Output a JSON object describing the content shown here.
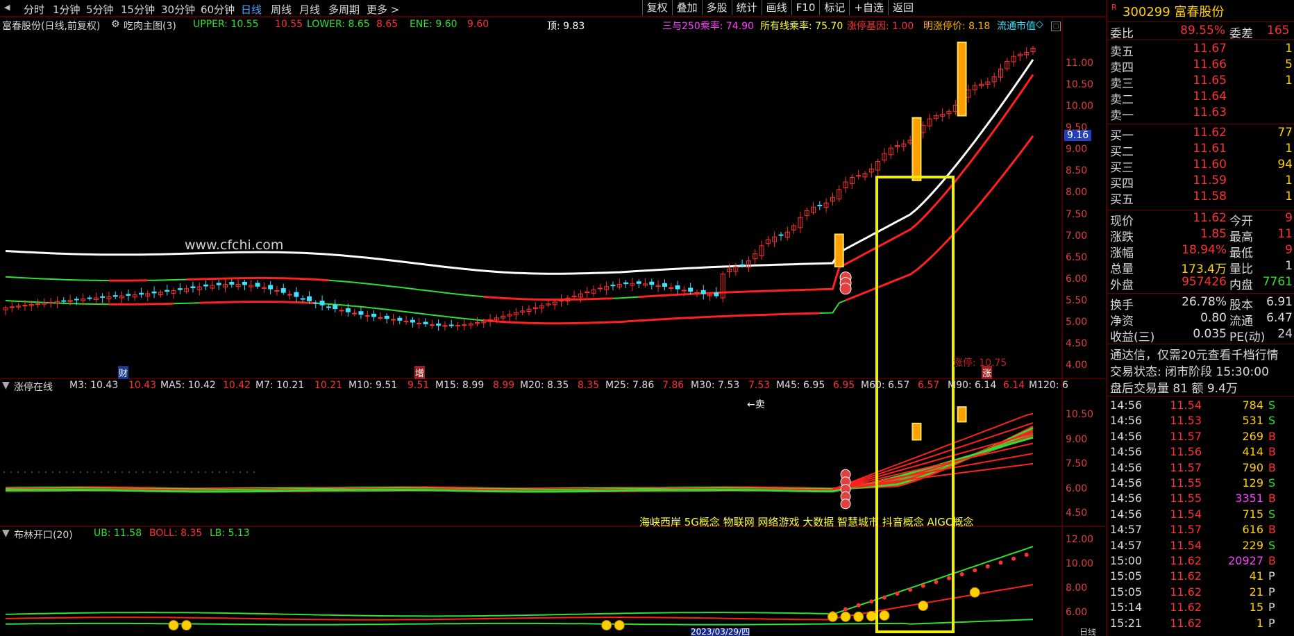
{
  "menu": {
    "periods": [
      "分时",
      "1分钟",
      "5分钟",
      "15分钟",
      "30分钟",
      "60分钟",
      "日线",
      "周线",
      "月线",
      "多周期",
      "更多"
    ],
    "active": "日线",
    "more_suffix": ">",
    "right_buttons": [
      "复权",
      "叠加",
      "多股",
      "统计",
      "画线",
      "F10",
      "标记",
      "+自选",
      "返回"
    ]
  },
  "main_panel": {
    "stock_title": "富春股份(日线,前复权)",
    "indicator_name": "吃肉主图(3)",
    "upper_label": "UPPER: 10.55",
    "upper_value": "10.55",
    "lower_label": "LOWER: 8.65",
    "lower_value": "8.65",
    "ene_label": "ENE: 9.60",
    "ene_value": "9.60",
    "top_label": "顶: 9.83",
    "ratio1": "三与250乘率: 74.90",
    "ratio2": "所有线乘率: 75.70",
    "limit_gene": "涨停基因: 1.00",
    "next_limit": "明涨停价: 8.18",
    "float_mv": "流通市值",
    "watermark": "www.cfchi.com",
    "price_tag": "9.16",
    "limit_text": "涨停: 10.75",
    "marker_cai": "财",
    "marker_zeng": "增",
    "marker_zhang": "涨",
    "y_ticks": [
      "11.00",
      "10.50",
      "10.00",
      "9.50",
      "9.00",
      "8.50",
      "8.00",
      "7.50",
      "7.00",
      "6.50",
      "6.00",
      "5.50",
      "5.00",
      "4.50",
      "4.00"
    ]
  },
  "ma_panel": {
    "name": "涨停在线",
    "items": [
      {
        "label": "M3: 10.43",
        "value": "10.43"
      },
      {
        "label": "MA5: 10.42",
        "value": "10.42"
      },
      {
        "label": "M7: 10.21",
        "value": "10.21"
      },
      {
        "label": "M10: 9.51",
        "value": "9.51"
      },
      {
        "label": "M15: 8.99",
        "value": "8.99"
      },
      {
        "label": "M20: 8.35",
        "value": "8.35"
      },
      {
        "label": "M25: 7.86",
        "value": "7.86"
      },
      {
        "label": "M30: 7.53",
        "value": "7.53"
      },
      {
        "label": "M45: 6.95",
        "value": "6.95"
      },
      {
        "label": "M60: 6.57",
        "value": "6.57"
      },
      {
        "label": "M90: 6.14",
        "value": "6.14"
      },
      {
        "label": "M120: 6",
        "value": ""
      }
    ],
    "sell_label": "←卖",
    "concepts": "海峡西岸 5G概念 物联网 网络游戏 大数据 智慧城市 抖音概念 AIGC概念",
    "y_ticks": [
      "10.50",
      "9.00",
      "7.50",
      "6.00",
      "4.50"
    ]
  },
  "boll_panel": {
    "name": "布林开口(20)",
    "ub_label": "UB: 11.58",
    "boll_label": "BOLL: 8.35",
    "lb_label": "LB: 5.13",
    "y_ticks": [
      "12.00",
      "10.00",
      "8.00",
      "6.00"
    ],
    "footer_date": "2023/03/29/四",
    "footer_right": "日线"
  },
  "quote": {
    "badge": "R",
    "code_name": "300299 富春股份",
    "weibi_label": "委比",
    "weibi_value": "89.55%",
    "weicha_label": "委差",
    "weicha_value": "165",
    "asks": [
      {
        "label": "卖五",
        "price": "11.67",
        "vol": "1"
      },
      {
        "label": "卖四",
        "price": "11.66",
        "vol": "5"
      },
      {
        "label": "卖三",
        "price": "11.65",
        "vol": "1"
      },
      {
        "label": "卖二",
        "price": "11.64",
        "vol": ""
      },
      {
        "label": "卖一",
        "price": "11.63",
        "vol": ""
      }
    ],
    "bids": [
      {
        "label": "买一",
        "price": "11.62",
        "vol": "77"
      },
      {
        "label": "买二",
        "price": "11.61",
        "vol": "1"
      },
      {
        "label": "买三",
        "price": "11.60",
        "vol": "94"
      },
      {
        "label": "买四",
        "price": "11.59",
        "vol": "1"
      },
      {
        "label": "买五",
        "price": "11.58",
        "vol": "1"
      }
    ],
    "stats": [
      {
        "l1": "现价",
        "v1": "11.62",
        "l2": "今开",
        "v2": "9"
      },
      {
        "l1": "涨跌",
        "v1": "1.85",
        "l2": "最高",
        "v2": "11"
      },
      {
        "l1": "涨幅",
        "v1": "18.94%",
        "l2": "最低",
        "v2": "9"
      },
      {
        "l1": "总量",
        "v1": "173.4万",
        "l2": "量比",
        "v2": "1"
      },
      {
        "l1": "外盘",
        "v1": "957426",
        "l2": "内盘",
        "v2": "7761"
      }
    ],
    "fund": [
      {
        "l1": "换手",
        "v1": "26.78%",
        "l2": "股本",
        "v2": "6.91"
      },
      {
        "l1": "净资",
        "v1": "0.80",
        "l2": "流通",
        "v2": "6.47"
      },
      {
        "l1": "收益(三)",
        "v1": "0.035",
        "l2": "PE(动)",
        "v2": "24"
      }
    ],
    "notice": "通达信，仅需20元查看千档行情",
    "trade_status": "交易状态: 闭市阶段 15:30:00",
    "after_hours": "盘后交易量 81 额 9.4万",
    "ticks": [
      {
        "t": "14:56",
        "p": "11.54",
        "v": "784",
        "s": "S"
      },
      {
        "t": "14:56",
        "p": "11.53",
        "v": "531",
        "s": "S"
      },
      {
        "t": "14:56",
        "p": "11.57",
        "v": "269",
        "s": "B"
      },
      {
        "t": "14:56",
        "p": "11.56",
        "v": "414",
        "s": "B"
      },
      {
        "t": "14:56",
        "p": "11.57",
        "v": "790",
        "s": "B"
      },
      {
        "t": "14:56",
        "p": "11.55",
        "v": "129",
        "s": "S"
      },
      {
        "t": "14:56",
        "p": "11.55",
        "v": "3351",
        "s": "B"
      },
      {
        "t": "14:56",
        "p": "11.54",
        "v": "715",
        "s": "S"
      },
      {
        "t": "14:57",
        "p": "11.57",
        "v": "616",
        "s": "B"
      },
      {
        "t": "14:57",
        "p": "11.54",
        "v": "229",
        "s": "S"
      },
      {
        "t": "15:00",
        "p": "11.62",
        "v": "20927",
        "s": "B"
      },
      {
        "t": "15:05",
        "p": "11.62",
        "v": "41",
        "s": "P"
      },
      {
        "t": "15:05",
        "p": "11.62",
        "v": "21",
        "s": "P"
      },
      {
        "t": "15:14",
        "p": "11.62",
        "v": "15",
        "s": "P"
      },
      {
        "t": "15:21",
        "p": "11.62",
        "v": "1",
        "s": "P"
      }
    ]
  },
  "colors": {
    "up": "#ff3030",
    "down": "#40e0ff",
    "green": "#30e030",
    "yellow": "#ffff30",
    "white": "#ffffff",
    "magenta": "#ff40ff",
    "orange": "#ffb000"
  }
}
